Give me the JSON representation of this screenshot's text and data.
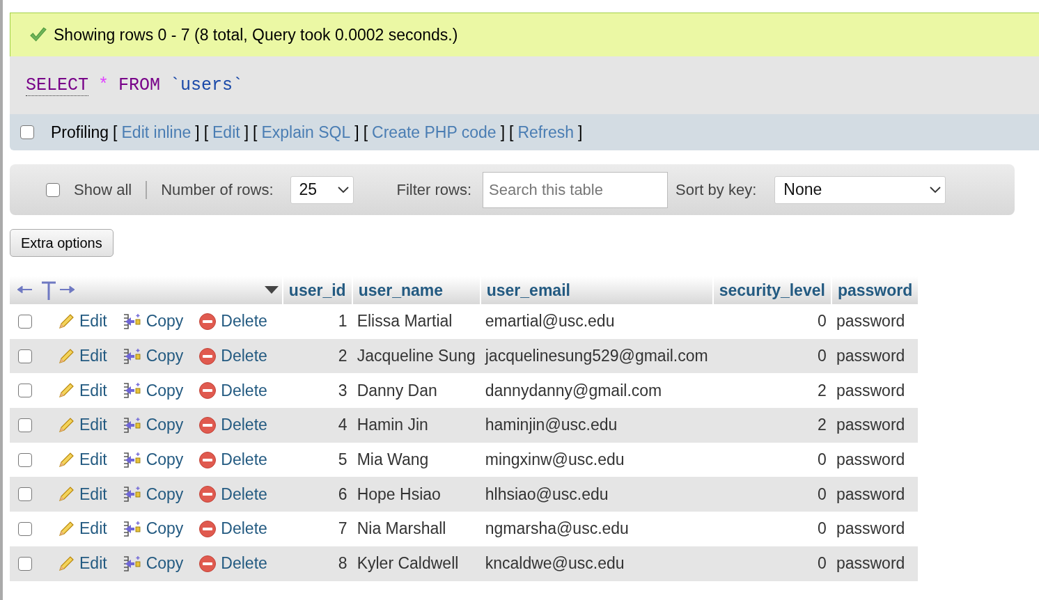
{
  "message": {
    "text": "Showing rows 0 - 7 (8 total, Query took 0.0002 seconds.)"
  },
  "sql": [
    {
      "text": "SELECT",
      "kind": "keyword"
    },
    {
      "text": "*",
      "kind": "operator"
    },
    {
      "text": "FROM",
      "kind": "keyword"
    },
    {
      "text": "`users`",
      "kind": "identifier"
    }
  ],
  "profiling": {
    "checked": false,
    "label": "Profiling",
    "parts": [
      {
        "kind": "bracket",
        "text": "["
      },
      {
        "kind": "link",
        "text": "Edit inline"
      },
      {
        "kind": "bracket",
        "text": "]"
      },
      {
        "kind": "bracket",
        "text": "["
      },
      {
        "kind": "link",
        "text": "Edit"
      },
      {
        "kind": "bracket",
        "text": "]"
      },
      {
        "kind": "bracket",
        "text": "["
      },
      {
        "kind": "link",
        "text": "Explain SQL"
      },
      {
        "kind": "bracket",
        "text": "]"
      },
      {
        "kind": "bracket",
        "text": "["
      },
      {
        "kind": "link",
        "text": "Create PHP code"
      },
      {
        "kind": "bracket",
        "text": "]"
      },
      {
        "kind": "bracket",
        "text": "["
      },
      {
        "kind": "link",
        "text": "Refresh"
      },
      {
        "kind": "bracket",
        "text": "]"
      }
    ]
  },
  "navigation": {
    "show_all": {
      "label": "Show all",
      "checked": false
    },
    "rows_label": "Number of rows:",
    "rows_value": "25",
    "filter_label": "Filter rows:",
    "filter_placeholder": "Search this table",
    "sort_label": "Sort by key:",
    "sort_value": "None"
  },
  "extra_options_button": "Extra options",
  "table": {
    "columns": [
      "user_id",
      "user_name",
      "user_email",
      "security_level",
      "password"
    ],
    "rows": [
      {
        "checked": false,
        "actions": [
          {
            "kind": "edit",
            "label": "Edit"
          },
          {
            "kind": "copy",
            "label": "Copy"
          },
          {
            "kind": "delete",
            "label": "Delete"
          }
        ],
        "cells": [
          "1",
          "Elissa Martial",
          "emartial@usc.edu",
          "0",
          "password"
        ]
      },
      {
        "checked": false,
        "actions": [
          {
            "kind": "edit",
            "label": "Edit"
          },
          {
            "kind": "copy",
            "label": "Copy"
          },
          {
            "kind": "delete",
            "label": "Delete"
          }
        ],
        "cells": [
          "2",
          "Jacqueline Sung",
          "jacquelinesung529@gmail.com",
          "0",
          "password"
        ]
      },
      {
        "checked": false,
        "actions": [
          {
            "kind": "edit",
            "label": "Edit"
          },
          {
            "kind": "copy",
            "label": "Copy"
          },
          {
            "kind": "delete",
            "label": "Delete"
          }
        ],
        "cells": [
          "3",
          "Danny Dan",
          "dannydanny@gmail.com",
          "2",
          "password"
        ]
      },
      {
        "checked": false,
        "actions": [
          {
            "kind": "edit",
            "label": "Edit"
          },
          {
            "kind": "copy",
            "label": "Copy"
          },
          {
            "kind": "delete",
            "label": "Delete"
          }
        ],
        "cells": [
          "4",
          "Hamin Jin",
          "haminjin@usc.edu",
          "2",
          "password"
        ]
      },
      {
        "checked": false,
        "actions": [
          {
            "kind": "edit",
            "label": "Edit"
          },
          {
            "kind": "copy",
            "label": "Copy"
          },
          {
            "kind": "delete",
            "label": "Delete"
          }
        ],
        "cells": [
          "5",
          "Mia Wang",
          "mingxinw@usc.edu",
          "0",
          "password"
        ]
      },
      {
        "checked": false,
        "actions": [
          {
            "kind": "edit",
            "label": "Edit"
          },
          {
            "kind": "copy",
            "label": "Copy"
          },
          {
            "kind": "delete",
            "label": "Delete"
          }
        ],
        "cells": [
          "6",
          "Hope Hsiao",
          "hlhsiao@usc.edu",
          "0",
          "password"
        ]
      },
      {
        "checked": false,
        "actions": [
          {
            "kind": "edit",
            "label": "Edit"
          },
          {
            "kind": "copy",
            "label": "Copy"
          },
          {
            "kind": "delete",
            "label": "Delete"
          }
        ],
        "cells": [
          "7",
          "Nia Marshall",
          "ngmarsha@usc.edu",
          "0",
          "password"
        ]
      },
      {
        "checked": false,
        "actions": [
          {
            "kind": "edit",
            "label": "Edit"
          },
          {
            "kind": "copy",
            "label": "Copy"
          },
          {
            "kind": "delete",
            "label": "Delete"
          }
        ],
        "cells": [
          "8",
          "Kyler Caldwell",
          "kncaldwe@usc.edu",
          "0",
          "password"
        ]
      }
    ]
  }
}
